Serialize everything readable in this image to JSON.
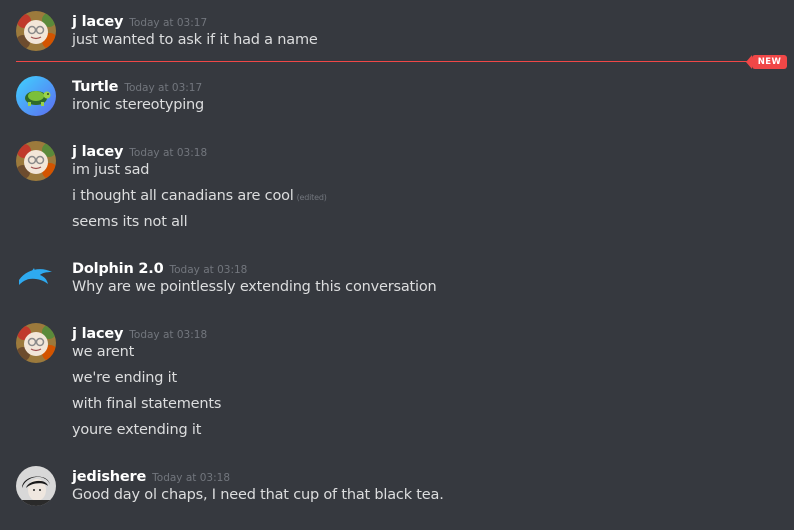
{
  "new_marker": {
    "label": "NEW"
  },
  "messages": [
    {
      "author": "j lacey",
      "avatar": "flower-cartoon-avatar",
      "timestamp": "Today at 03:17",
      "lines": [
        "just wanted to ask if it had a name"
      ]
    },
    {
      "author": "Turtle",
      "avatar": "turtle-avatar",
      "timestamp": "Today at 03:17",
      "lines": [
        "ironic stereotyping"
      ]
    },
    {
      "author": "j lacey",
      "avatar": "flower-cartoon-avatar",
      "timestamp": "Today at 03:18",
      "lines": [
        "im just sad",
        "i thought all canadians are cool",
        "seems its not all"
      ],
      "edited_label": "(edited)"
    },
    {
      "author": "Dolphin 2.0",
      "avatar": "dolphin-logo-avatar",
      "timestamp": "Today at 03:18",
      "lines": [
        "Why are we pointlessly extending this conversation"
      ]
    },
    {
      "author": "j lacey",
      "avatar": "flower-cartoon-avatar",
      "timestamp": "Today at 03:18",
      "lines": [
        "we arent",
        "we're ending it",
        "with final statements",
        "youre extending it"
      ]
    },
    {
      "author": "jedishere",
      "avatar": "grayscale-portrait-avatar",
      "timestamp": "Today at 03:18",
      "lines": [
        "Good day ol chaps, I need that cup of that black tea."
      ]
    }
  ],
  "colors": {
    "background": "#36393f",
    "username": "#ffffff",
    "message_text": "#dcddde",
    "timestamp": "#72767d",
    "new_divider": "#f04747",
    "dolphin_blue": "#2eaaf0"
  }
}
